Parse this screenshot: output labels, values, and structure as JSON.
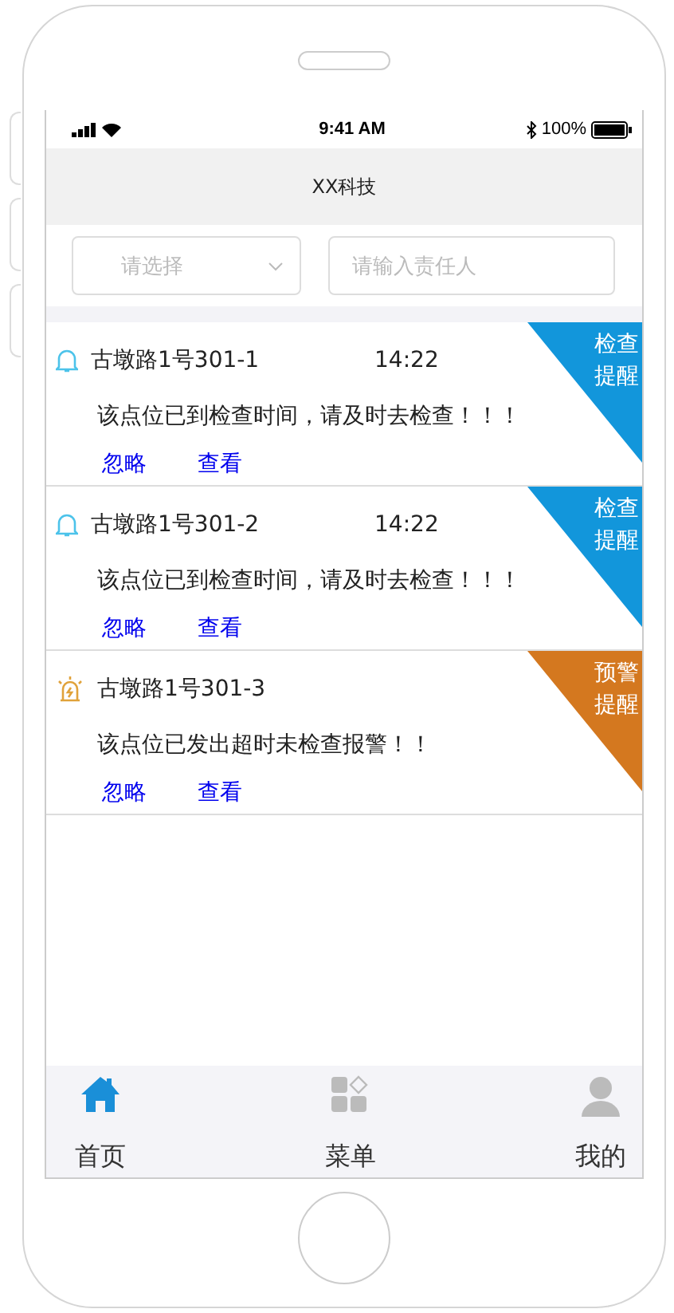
{
  "status_bar": {
    "time": "9:41 AM",
    "battery": "100%"
  },
  "title": "XX科技",
  "filters": {
    "select": {
      "placeholder": "请选择"
    },
    "person": {
      "placeholder": "请输入责任人"
    }
  },
  "alerts": [
    {
      "kind": "inspect",
      "location": "古墩路1号301-1",
      "time": "14:22",
      "message": "该点位已到检查时间，请及时去检查！！！",
      "tag": [
        "检查",
        "提醒"
      ],
      "color": "#1296db",
      "actions": [
        "忽略",
        "查看"
      ]
    },
    {
      "kind": "inspect",
      "location": "古墩路1号301-2",
      "time": "14:22",
      "message": "该点位已到检查时间，请及时去检查！！！",
      "tag": [
        "检查",
        "提醒"
      ],
      "color": "#1296db",
      "actions": [
        "忽略",
        "查看"
      ]
    },
    {
      "kind": "warning",
      "location": "古墩路1号301-3",
      "message": "该点位已发出超时未检查报警！！",
      "tag": [
        "预警",
        "提醒"
      ],
      "color": "#d4781f",
      "actions": [
        "忽略",
        "查看"
      ]
    }
  ],
  "tabs": [
    {
      "kind": "home",
      "label": "首页",
      "selected": true
    },
    {
      "kind": "menu",
      "label": "菜单",
      "selected": false
    },
    {
      "kind": "profile",
      "label": "我的",
      "selected": false
    }
  ]
}
